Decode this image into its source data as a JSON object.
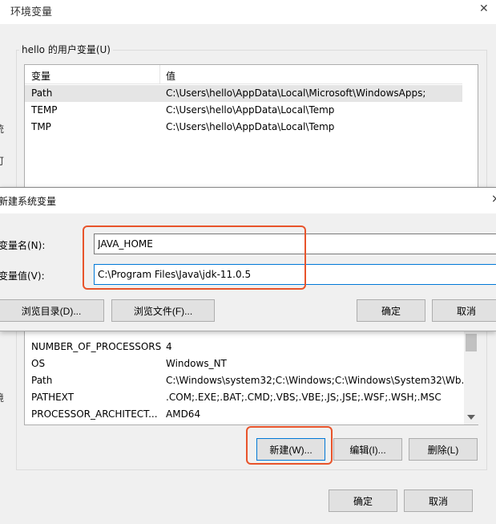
{
  "window": {
    "title": "环境变量",
    "close_glyph": "✕"
  },
  "user_vars": {
    "group_label": "hello 的用户变量(U)",
    "headers": {
      "name": "变量",
      "value": "值"
    },
    "rows": [
      {
        "name": "Path",
        "value": "C:\\Users\\hello\\AppData\\Local\\Microsoft\\WindowsApps;"
      },
      {
        "name": "TEMP",
        "value": "C:\\Users\\hello\\AppData\\Local\\Temp"
      },
      {
        "name": "TMP",
        "value": "C:\\Users\\hello\\AppData\\Local\\Temp"
      }
    ]
  },
  "left_edge_glyphs": [
    "统",
    "可",
    "境"
  ],
  "system_vars": {
    "rows": [
      {
        "name": "NUMBER_OF_PROCESSORS",
        "value": "4"
      },
      {
        "name": "OS",
        "value": "Windows_NT"
      },
      {
        "name": "Path",
        "value": "C:\\Windows\\system32;C:\\Windows;C:\\Windows\\System32\\Wb..."
      },
      {
        "name": "PATHEXT",
        "value": ".COM;.EXE;.BAT;.CMD;.VBS;.VBE;.JS;.JSE;.WSF;.WSH;.MSC"
      },
      {
        "name": "PROCESSOR_ARCHITECT...",
        "value": "AMD64"
      }
    ],
    "buttons": {
      "new": "新建(W)...",
      "edit": "编辑(I)...",
      "delete": "删除(L)"
    }
  },
  "footer": {
    "ok": "确定",
    "cancel": "取消"
  },
  "new_var_dialog": {
    "title": "新建系统变量",
    "close_glyph": "×",
    "name_label": "变量名(N):",
    "name_value": "JAVA_HOME",
    "value_label": "变量值(V):",
    "value_value": "C:\\Program Files\\Java\\jdk-11.0.5",
    "buttons": {
      "browse_dir": "浏览目录(D)...",
      "browse_file": "浏览文件(F)...",
      "ok": "确定",
      "cancel": "取消"
    }
  },
  "colors": {
    "highlight": "#e8542b",
    "selected_row": "#e5e5e5",
    "button_face": "#e1e1e1",
    "window_bg": "#f0f0f0"
  }
}
